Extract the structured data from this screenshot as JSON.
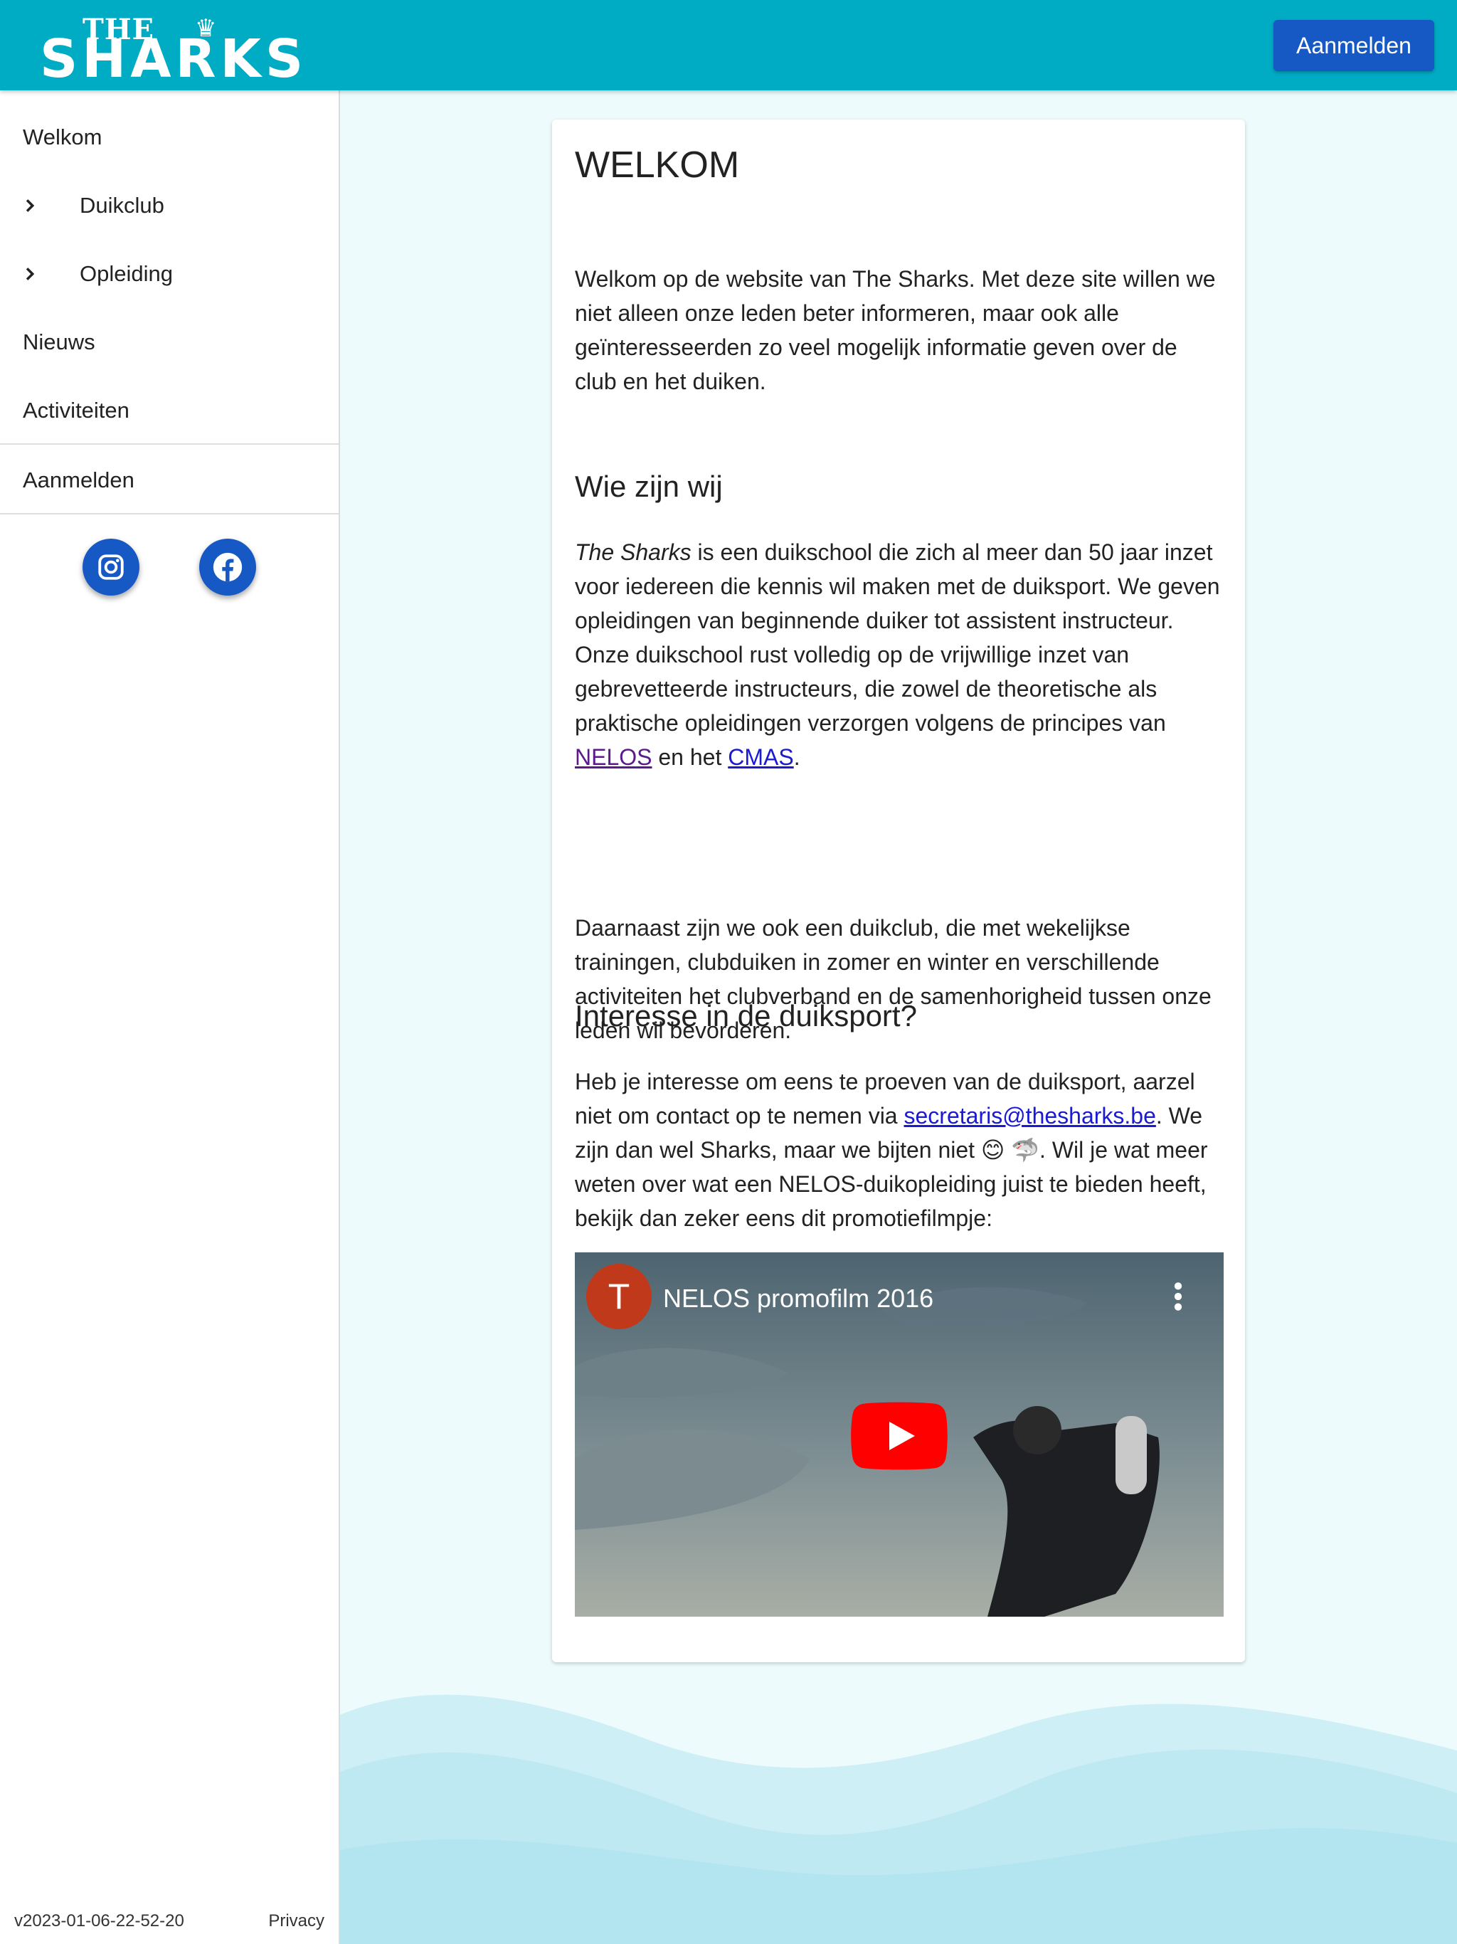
{
  "header": {
    "logo_top": "THE",
    "logo_main": "SHARKS",
    "signin_label": "Aanmelden"
  },
  "sidebar": {
    "items": [
      {
        "label": "Welkom"
      },
      {
        "label": "Duikclub"
      },
      {
        "label": "Opleiding"
      },
      {
        "label": "Nieuws"
      },
      {
        "label": "Activiteiten"
      },
      {
        "label": "Aanmelden"
      }
    ],
    "social": [
      "instagram-icon",
      "facebook-icon"
    ],
    "version": "v2023-01-06-22-52-20",
    "privacy": "Privacy"
  },
  "main": {
    "title": "WELKOM",
    "intro": "Welkom op de website van The Sharks. Met deze site willen we niet alleen onze leden beter informeren, maar ook alle geïnteresseerden zo veel mogelijk informatie geven over de club en het duiken.",
    "who_heading": "Wie zijn wij",
    "who_p1_em": "The Sharks",
    "who_p1_a": " is een duikschool die zich al meer dan 50 jaar inzet voor iedereen die kennis wil maken met de duiksport. We geven opleidingen van beginnende duiker tot assistent instructeur. Onze duikschool rust volledig op de vrijwillige inzet van gebrevetteerde instructeurs, die zowel de theoretische als praktische opleidingen verzorgen volgens de principes van ",
    "who_p1_link1": "NELOS",
    "who_p1_mid": " en het ",
    "who_p1_link2": "CMAS",
    "who_p1_end": ".",
    "who_p2": "Daarnaast zijn we ook een duikclub, die met wekelijkse trainingen, clubduiken in zomer en winter en verschillende activiteiten het clubverband en de samenhorigheid tussen onze leden wil bevorderen.",
    "interest_heading": "Interesse in de duiksport?",
    "interest_a": "Heb je interesse om eens te proeven van de duiksport, aarzel niet om contact op te nemen via ",
    "interest_email": "secretaris@thesharks.be",
    "interest_b": ". We zijn dan wel Sharks, maar we bijten niet ",
    "interest_emoji": "😊 🦈",
    "interest_c": ". Wil je wat meer weten over wat een NELOS-duikopleiding juist te bieden heeft, bekijk dan zeker eens dit promotiefilmpje:",
    "video": {
      "channel_initial": "T",
      "title": "NELOS promofilm 2016"
    }
  },
  "colors": {
    "header": "#00abc4",
    "button": "#1659c5",
    "background": "#eefbfd"
  }
}
